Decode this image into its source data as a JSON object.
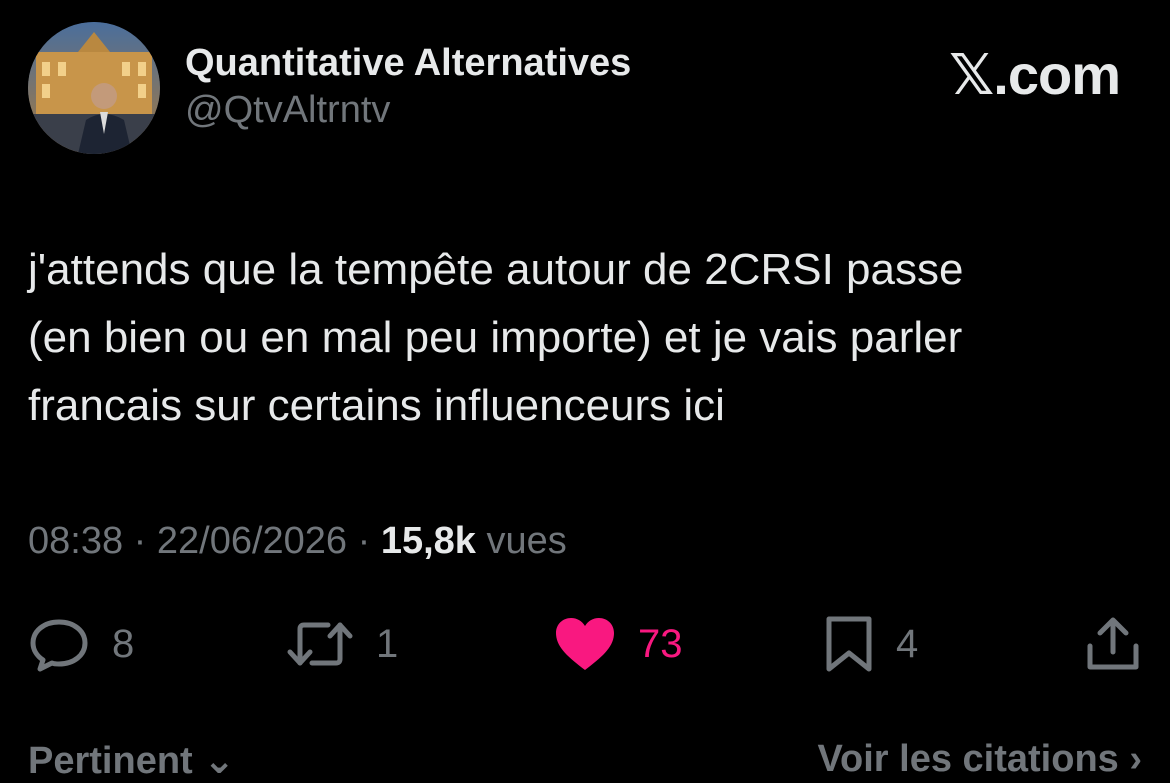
{
  "author": {
    "display_name": "Quantitative Alternatives",
    "handle": "@QtvAltrntv"
  },
  "brand": {
    "label": "𝕏.com"
  },
  "tweet": {
    "text": "j'attends que la tempête autour de 2CRSI passe\n(en bien ou en mal peu importe) et je vais parler\nfrancais sur certains influenceurs ici"
  },
  "meta": {
    "time": "08:38",
    "separator": "·",
    "date": "22/06/2026",
    "views_count": "15,8k",
    "views_label": "vues"
  },
  "actions": {
    "replies": "8",
    "reposts": "1",
    "likes": "73",
    "bookmarks": "4",
    "reply_icon": "speech-bubble-icon",
    "repost_icon": "repost-arrows-icon",
    "like_icon": "heart-filled-icon",
    "bookmark_icon": "bookmark-icon",
    "share_icon": "share-upload-icon"
  },
  "footer": {
    "sort_label": "Pertinent ⌄",
    "quotes_label": "Voir les citations ›"
  },
  "colors": {
    "background": "#000000",
    "primary_text": "#e7e9ea",
    "secondary_text": "#71767b",
    "like_pink": "#f91880"
  }
}
